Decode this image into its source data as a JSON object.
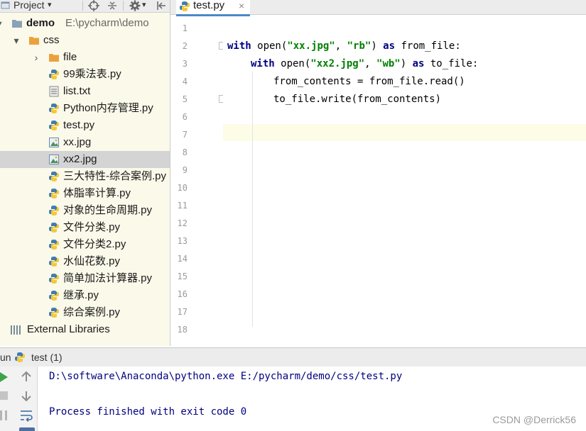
{
  "project_panel": {
    "title": "Project",
    "root": {
      "name": "demo",
      "path": "E:\\pycharm\\demo"
    },
    "items": [
      {
        "label": "css",
        "type": "folder"
      },
      {
        "label": "file",
        "type": "folder"
      },
      {
        "label": "99乘法表.py",
        "type": "python"
      },
      {
        "label": "list.txt",
        "type": "text"
      },
      {
        "label": "Python内存管理.py",
        "type": "python"
      },
      {
        "label": "test.py",
        "type": "python"
      },
      {
        "label": "xx.jpg",
        "type": "image"
      },
      {
        "label": "xx2.jpg",
        "type": "image",
        "selected": true
      },
      {
        "label": "三大特性-综合案例.py",
        "type": "python"
      },
      {
        "label": "体脂率计算.py",
        "type": "python"
      },
      {
        "label": "对象的生命周期.py",
        "type": "python"
      },
      {
        "label": "文件分类.py",
        "type": "python"
      },
      {
        "label": "文件分类2.py",
        "type": "python"
      },
      {
        "label": "水仙花数.py",
        "type": "python"
      },
      {
        "label": "简单加法计算器.py",
        "type": "python"
      },
      {
        "label": "继承.py",
        "type": "python"
      },
      {
        "label": "综合案例.py",
        "type": "python"
      }
    ],
    "external_libraries": "External Libraries"
  },
  "editor": {
    "tab_label": "test.py",
    "close_glyph": "×",
    "line_numbers": [
      "1",
      "2",
      "3",
      "4",
      "5",
      "6",
      "7",
      "8",
      "9",
      "10",
      "11",
      "12",
      "13",
      "14",
      "15",
      "16",
      "17",
      "18"
    ],
    "code": {
      "l2": {
        "kw1": "with",
        "fn": " open(",
        "s1": "\"xx.jpg\"",
        "c": ", ",
        "s2": "\"rb\"",
        "p": ") ",
        "kw2": "as",
        "v": " from_file:"
      },
      "l3": {
        "kw1": "with",
        "fn": " open(",
        "s1": "\"xx2.jpg\"",
        "c": ", ",
        "s2": "\"wb\"",
        "p": ") ",
        "kw2": "as",
        "v": " to_file:"
      },
      "l4": "from_contents = from_file.read()",
      "l5": "to_file.write(from_contents)"
    }
  },
  "run_panel": {
    "label": "un",
    "config": "test (1)",
    "console": {
      "command": "D:\\software\\Anaconda\\python.exe E:/pycharm/demo/css/test.py",
      "exit_message": "Process finished with exit code 0"
    }
  },
  "watermark": "CSDN @Derrick56",
  "colors": {
    "keyword": "#000080",
    "string": "#008000",
    "accent": "#4a88c7",
    "folder": "#e8a33d"
  }
}
